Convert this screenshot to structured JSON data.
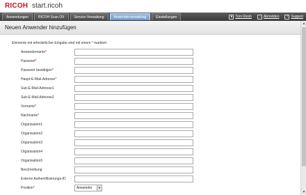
{
  "app": {
    "logo": "RICOH",
    "title": "start.ricoh"
  },
  "nav": {
    "tabs": [
      {
        "label": "Anwendungen",
        "active": false
      },
      {
        "label": "RICOH Scan OX",
        "active": false
      },
      {
        "label": "Service-Verwaltung",
        "active": false
      },
      {
        "label": "Anwenderverwaltung",
        "active": true
      },
      {
        "label": "Einstellungen",
        "active": false
      }
    ],
    "user": "Tom Ricoh",
    "logout": "Abmelden",
    "support": "Support"
  },
  "page": {
    "title": "Neuen Anwender hinzufügen",
    "notice_before": "Elemente mit erforderlicher Eingabe sind mit einem ",
    "notice_marker": "*",
    "notice_after": " markiert"
  },
  "form": {
    "fields": [
      {
        "label": "Anwendername",
        "required": true,
        "value": ""
      },
      {
        "label": "Passwort",
        "required": true,
        "value": ""
      },
      {
        "label": "Passwort bestätigen",
        "required": true,
        "value": ""
      },
      {
        "label": "Haupt-E-Mail-Adresse",
        "required": true,
        "value": ""
      },
      {
        "label": "Sub-E-Mail-Adresse1",
        "required": false,
        "value": ""
      },
      {
        "label": "Sub-E-Mail-Adresse2",
        "required": false,
        "value": ""
      },
      {
        "label": "Vorname",
        "required": true,
        "value": ""
      },
      {
        "label": "Nachname",
        "required": true,
        "value": ""
      },
      {
        "label": "Organisation1",
        "required": false,
        "value": ""
      },
      {
        "label": "Organisation2",
        "required": false,
        "value": ""
      },
      {
        "label": "Organisation3",
        "required": false,
        "value": ""
      },
      {
        "label": "Organisation4",
        "required": false,
        "value": ""
      },
      {
        "label": "Organisation5",
        "required": false,
        "value": ""
      },
      {
        "label": "Beschreibung",
        "required": false,
        "value": ""
      },
      {
        "label": "Externe Authentifizierungs-ID",
        "required": false,
        "value": ""
      }
    ],
    "position": {
      "label": "Position",
      "required": true,
      "selected": "Anwender"
    }
  },
  "colors": {
    "brand": "#c8102e",
    "nav_bg": "#4a4a4a",
    "active_tab": "#7ea5d4",
    "required": "#dd0000"
  }
}
